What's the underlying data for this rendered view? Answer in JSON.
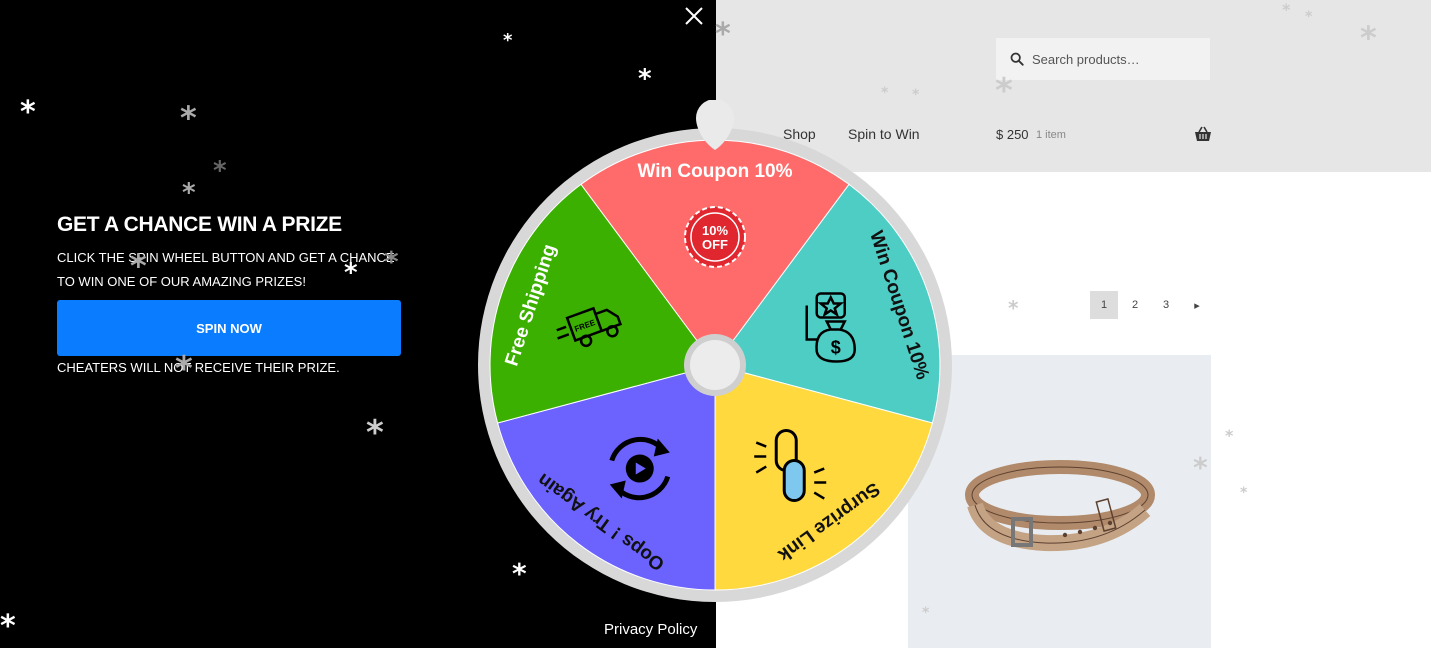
{
  "store": {
    "search_placeholder": "Search products…",
    "nav": {
      "shop": "Shop",
      "spin_to_win": "Spin to Win"
    },
    "cart": {
      "amount": "$ 250",
      "count": "1 item"
    },
    "pagination": [
      "1",
      "2",
      "3"
    ]
  },
  "popup": {
    "headline": "GET A CHANCE WIN A PRIZE",
    "subtext": "CLICK THE SPIN WHEEL BUTTON AND GET A CHANCE TO WIN ONE OF OUR AMAZING PRIZES!",
    "button": "SPIN NOW",
    "warning": "CHEATERS WILL NOT RECEIVE THEIR PRIZE.",
    "privacy": "Privacy Policy"
  },
  "wheel": {
    "segments": [
      {
        "label": "Win Coupon 10%",
        "color": "#ff6b6b",
        "icon": "coupon-badge-icon",
        "badge": [
          "10%",
          "OFF"
        ]
      },
      {
        "label": "Win Coupon 10%",
        "color": "#4ecdc4",
        "icon": "money-bag-icon"
      },
      {
        "label": "Surprize Link",
        "color": "#ffd93d",
        "icon": "link-chain-icon"
      },
      {
        "label": "Oops ! Try Again",
        "color": "#6c63ff",
        "icon": "refresh-icon"
      },
      {
        "label": "Free Shipping",
        "color": "#3bb000",
        "icon": "delivery-truck-icon"
      }
    ]
  },
  "colors": {
    "panel": "#000000",
    "button": "#0a7cff",
    "header": "#e6e6e6"
  }
}
